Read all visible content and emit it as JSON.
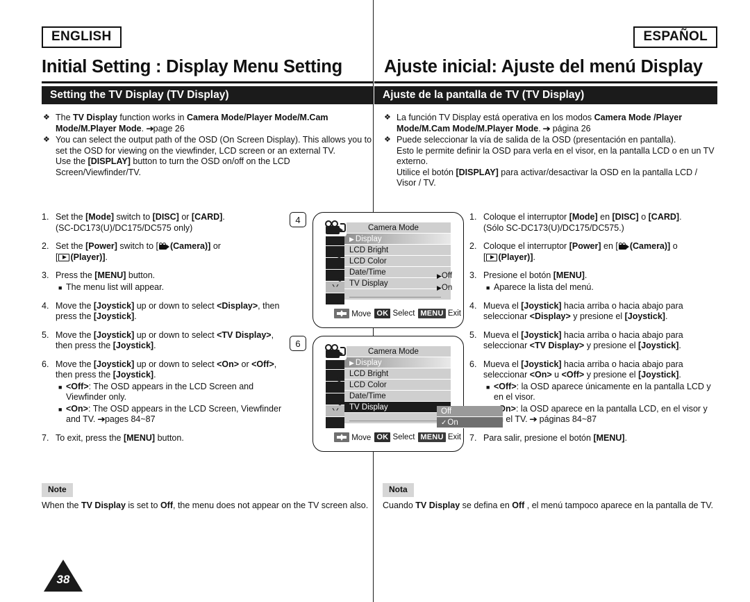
{
  "page": {
    "number": "38"
  },
  "english": {
    "lang_tag": "ENGLISH",
    "chapter_title": "Initial Setting : Display Menu Setting",
    "section_banner": "Setting the TV Display (TV Display)",
    "bullets": [
      {
        "marker": "diamond",
        "parts": [
          {
            "t": "The ",
            "b": false
          },
          {
            "t": "TV Display",
            "b": true
          },
          {
            "t": " function works in ",
            "b": false
          },
          {
            "t": "Camera Mode/Player Mode/M.Cam Mode/M.Player Mode",
            "b": true
          },
          {
            "t": ". ",
            "b": false
          },
          {
            "t": "page 26",
            "b": false,
            "arrow": true
          }
        ]
      },
      {
        "marker": "diamond",
        "parts": [
          {
            "t": "You can select the output path of the OSD (On Screen Display). This allows you to set the OSD for viewing on the viewfinder, LCD screen or an external TV.",
            "b": false
          },
          {
            "t": "BREAK",
            "b": false
          },
          {
            "t": "Use the ",
            "b": false
          },
          {
            "t": "[DISPLAY]",
            "b": true
          },
          {
            "t": " button to turn the OSD on/off on the LCD Screen/Viewfinder/TV.",
            "b": false
          }
        ]
      }
    ],
    "steps": [
      {
        "num": "1.",
        "parts": [
          {
            "t": "Set the ",
            "b": false
          },
          {
            "t": "[Mode]",
            "b": true
          },
          {
            "t": " switch to ",
            "b": false
          },
          {
            "t": "[DISC]",
            "b": true
          },
          {
            "t": " or ",
            "b": false
          },
          {
            "t": "[CARD]",
            "b": true
          },
          {
            "t": ".",
            "b": false
          },
          {
            "t": "BREAK",
            "b": false
          },
          {
            "t": "(SC-DC173(U)/DC175/DC575 only)",
            "b": false
          }
        ],
        "subs": []
      },
      {
        "num": "2.",
        "parts": [
          {
            "t": "Set the ",
            "b": false
          },
          {
            "t": "[Power]",
            "b": true
          },
          {
            "t": " switch to [",
            "b": false
          },
          {
            "t": "ICON_CAMERA",
            "b": false
          },
          {
            "t": "(Camera)]",
            "b": true
          },
          {
            "t": " or ",
            "b": false
          },
          {
            "t": "BREAK",
            "b": false
          },
          {
            "t": "[",
            "b": false
          },
          {
            "t": "ICON_PLAYER",
            "b": false
          },
          {
            "t": "(Player)]",
            "b": true
          },
          {
            "t": ".",
            "b": false
          }
        ],
        "subs": []
      },
      {
        "num": "3.",
        "parts": [
          {
            "t": "Press the ",
            "b": false
          },
          {
            "t": "[MENU]",
            "b": true
          },
          {
            "t": " button.",
            "b": false
          }
        ],
        "subs": [
          {
            "parts": [
              {
                "t": "The menu list will appear.",
                "b": false
              }
            ]
          }
        ]
      },
      {
        "num": "4.",
        "parts": [
          {
            "t": "Move the ",
            "b": false
          },
          {
            "t": "[Joystick]",
            "b": true
          },
          {
            "t": " up or down to select ",
            "b": false
          },
          {
            "t": "<Display>",
            "b": true
          },
          {
            "t": ", then press the ",
            "b": false
          },
          {
            "t": "[Joystick]",
            "b": true
          },
          {
            "t": ".",
            "b": false
          }
        ],
        "subs": []
      },
      {
        "num": "5.",
        "parts": [
          {
            "t": "Move the ",
            "b": false
          },
          {
            "t": "[Joystick]",
            "b": true
          },
          {
            "t": " up or down to select ",
            "b": false
          },
          {
            "t": "<TV Display>",
            "b": true
          },
          {
            "t": ", then press the ",
            "b": false
          },
          {
            "t": "[Joystick]",
            "b": true
          },
          {
            "t": ".",
            "b": false
          }
        ],
        "subs": []
      },
      {
        "num": "6.",
        "parts": [
          {
            "t": "Move the ",
            "b": false
          },
          {
            "t": "[Joystick]",
            "b": true
          },
          {
            "t": " up or down to select ",
            "b": false
          },
          {
            "t": "<On>",
            "b": true
          },
          {
            "t": " or ",
            "b": false
          },
          {
            "t": "<Off>",
            "b": true
          },
          {
            "t": ", then press the ",
            "b": false
          },
          {
            "t": "[Joystick]",
            "b": true
          },
          {
            "t": ".",
            "b": false
          }
        ],
        "subs": [
          {
            "parts": [
              {
                "t": "<Off>",
                "b": true
              },
              {
                "t": ": The OSD appears in the LCD Screen and Viewfinder only.",
                "b": false
              }
            ]
          },
          {
            "parts": [
              {
                "t": "<On>",
                "b": true
              },
              {
                "t": ": The OSD appears in the LCD Screen, Viewfinder and TV. ",
                "b": false
              },
              {
                "t": "pages 84~87",
                "b": false,
                "arrow": true
              }
            ]
          }
        ]
      },
      {
        "num": "7.",
        "parts": [
          {
            "t": "To exit, press the ",
            "b": false
          },
          {
            "t": "[MENU]",
            "b": true
          },
          {
            "t": " button.",
            "b": false
          }
        ],
        "subs": []
      }
    ],
    "note": {
      "tag": "Note",
      "parts": [
        {
          "t": "When the ",
          "b": false
        },
        {
          "t": "TV Display",
          "b": true
        },
        {
          "t": " is set to ",
          "b": false
        },
        {
          "t": "Off",
          "b": true
        },
        {
          "t": ", the menu does not appear on the TV screen also.",
          "b": false
        }
      ]
    }
  },
  "spanish": {
    "lang_tag": "ESPAÑOL",
    "chapter_title": "Ajuste inicial: Ajuste del menú Display",
    "section_banner": "Ajuste de la pantalla de TV (TV Display)",
    "bullets": [
      {
        "marker": "diamond",
        "parts": [
          {
            "t": "La función TV Display está operativa en los modos ",
            "b": false
          },
          {
            "t": "Camera Mode /Player Mode/M.Cam Mode/M.Player Mode",
            "b": true
          },
          {
            "t": ". ",
            "b": false
          },
          {
            "t": " página 26",
            "b": false,
            "arrow": true
          }
        ]
      },
      {
        "marker": "diamond",
        "parts": [
          {
            "t": "Puede seleccionar la vía de salida de la OSD (presentación en pantalla).",
            "b": false
          },
          {
            "t": "BREAK",
            "b": false
          },
          {
            "t": "Esto le permite definir la OSD para verla en el visor, en la pantalla LCD o en un TV externo.",
            "b": false
          },
          {
            "t": "BREAK",
            "b": false
          },
          {
            "t": "Utilice el botón ",
            "b": false
          },
          {
            "t": "[DISPLAY]",
            "b": true
          },
          {
            "t": " para activar/desactivar la OSD en la pantalla LCD / Visor / TV.",
            "b": false
          }
        ]
      }
    ],
    "steps": [
      {
        "num": "1.",
        "parts": [
          {
            "t": "Coloque el interruptor ",
            "b": false
          },
          {
            "t": "[Mode]",
            "b": true
          },
          {
            "t": " en ",
            "b": false
          },
          {
            "t": "[DISC]",
            "b": true
          },
          {
            "t": " o ",
            "b": false
          },
          {
            "t": "[CARD]",
            "b": true
          },
          {
            "t": ".",
            "b": false
          },
          {
            "t": "BREAK",
            "b": false
          },
          {
            "t": "(Sólo SC-DC173(U)/DC175/DC575.)",
            "b": false
          }
        ],
        "subs": []
      },
      {
        "num": "2.",
        "parts": [
          {
            "t": "Coloque el interruptor ",
            "b": false
          },
          {
            "t": "[Power]",
            "b": true
          },
          {
            "t": " en [",
            "b": false
          },
          {
            "t": "ICON_CAMERA",
            "b": false
          },
          {
            "t": "(Camera)]",
            "b": true
          },
          {
            "t": " o ",
            "b": false
          },
          {
            "t": "BREAK",
            "b": false
          },
          {
            "t": "[",
            "b": false
          },
          {
            "t": "ICON_PLAYER",
            "b": false
          },
          {
            "t": "(Player)]",
            "b": true
          },
          {
            "t": ".",
            "b": false
          }
        ],
        "subs": []
      },
      {
        "num": "3.",
        "parts": [
          {
            "t": "Presione el botón ",
            "b": false
          },
          {
            "t": "[MENU]",
            "b": true
          },
          {
            "t": ".",
            "b": false
          }
        ],
        "subs": [
          {
            "parts": [
              {
                "t": "Aparece la lista del menú.",
                "b": false
              }
            ]
          }
        ]
      },
      {
        "num": "4.",
        "parts": [
          {
            "t": "Mueva el ",
            "b": false
          },
          {
            "t": "[Joystick]",
            "b": true
          },
          {
            "t": " hacia arriba o hacia abajo para seleccionar ",
            "b": false
          },
          {
            "t": "<Display>",
            "b": true
          },
          {
            "t": " y presione el ",
            "b": false
          },
          {
            "t": "[Joystick]",
            "b": true
          },
          {
            "t": ".",
            "b": false
          }
        ],
        "subs": []
      },
      {
        "num": "5.",
        "parts": [
          {
            "t": "Mueva el ",
            "b": false
          },
          {
            "t": "[Joystick]",
            "b": true
          },
          {
            "t": " hacia arriba o hacia abajo para seleccionar ",
            "b": false
          },
          {
            "t": "<TV Display>",
            "b": true
          },
          {
            "t": " y presione el ",
            "b": false
          },
          {
            "t": "[Joystick]",
            "b": true
          },
          {
            "t": ".",
            "b": false
          }
        ],
        "subs": []
      },
      {
        "num": "6.",
        "parts": [
          {
            "t": "Mueva el ",
            "b": false
          },
          {
            "t": "[Joystick]",
            "b": true
          },
          {
            "t": " hacia arriba o hacia abajo para seleccionar ",
            "b": false
          },
          {
            "t": "<On>",
            "b": true
          },
          {
            "t": " u ",
            "b": false
          },
          {
            "t": "<Off>",
            "b": true
          },
          {
            "t": " y presione el ",
            "b": false
          },
          {
            "t": "[Joystick]",
            "b": true
          },
          {
            "t": ".",
            "b": false
          }
        ],
        "subs": [
          {
            "parts": [
              {
                "t": "<Off>",
                "b": true
              },
              {
                "t": ": la OSD aparece únicamente en la pantalla LCD y en el visor.",
                "b": false
              }
            ]
          },
          {
            "parts": [
              {
                "t": "<On>",
                "b": true
              },
              {
                "t": ": la OSD aparece en la pantalla LCD, en el visor y en el TV. ",
                "b": false
              },
              {
                "t": " páginas 84~87",
                "b": false,
                "arrow": true
              }
            ]
          }
        ]
      },
      {
        "num": "7.",
        "parts": [
          {
            "t": "Para salir, presione el botón ",
            "b": false
          },
          {
            "t": "[MENU]",
            "b": true
          },
          {
            "t": ".",
            "b": false
          }
        ],
        "subs": []
      }
    ],
    "note": {
      "tag": "Nota",
      "parts": [
        {
          "t": "Cuando ",
          "b": false
        },
        {
          "t": "TV Display",
          "b": true
        },
        {
          "t": " se defina en ",
          "b": false
        },
        {
          "t": "Off",
          "b": true
        },
        {
          "t": " , el menú tampoco aparece en la pantalla de TV.",
          "b": false
        }
      ]
    }
  },
  "illustrations": [
    {
      "step_tag": "4",
      "osd": {
        "title": "Camera Mode",
        "selected_row": "Display",
        "rows": [
          {
            "label": "Display",
            "value": "",
            "state": "selected",
            "caret": true
          },
          {
            "label": "LCD Bright",
            "value": "",
            "state": "normal",
            "caret": false
          },
          {
            "label": "LCD Color",
            "value": "",
            "state": "normal",
            "caret": false
          },
          {
            "label": "Date/Time",
            "value": "Off",
            "state": "normal",
            "caret": false
          },
          {
            "label": "TV Display",
            "value": "On",
            "state": "normal",
            "caret": false
          },
          {
            "label": "",
            "value": "",
            "state": "blank",
            "caret": false
          }
        ],
        "side_icons": [
          "record-icon",
          "tape-icon",
          "disc-icon",
          "tv-icon",
          "gear-icon"
        ],
        "highlighted_side_icon": "tv-icon",
        "hints": [
          {
            "key": "dpad",
            "label": "Move"
          },
          {
            "key": "OK",
            "label": "Select"
          },
          {
            "key": "MENU",
            "label": "Exit"
          }
        ]
      }
    },
    {
      "step_tag": "6",
      "osd": {
        "title": "Camera Mode",
        "selected_row": "TV Display",
        "rows": [
          {
            "label": "Display",
            "value": "",
            "state": "selected",
            "caret": true
          },
          {
            "label": "LCD Bright",
            "value": "",
            "state": "normal",
            "caret": false
          },
          {
            "label": "LCD Color",
            "value": "",
            "state": "normal",
            "caret": false
          },
          {
            "label": "Date/Time",
            "value": "",
            "state": "normal",
            "caret": false
          },
          {
            "label": "TV Display",
            "value": "",
            "state": "dark",
            "caret": false
          },
          {
            "label": "",
            "value": "",
            "state": "blank",
            "caret": false
          }
        ],
        "submenu": {
          "options": [
            {
              "label": "Off",
              "checked": false
            },
            {
              "label": "On",
              "checked": true
            }
          ]
        },
        "side_icons": [
          "record-icon",
          "tape-icon",
          "disc-icon",
          "tv-icon",
          "gear-icon"
        ],
        "highlighted_side_icon": "tv-icon",
        "hints": [
          {
            "key": "dpad",
            "label": "Move"
          },
          {
            "key": "OK",
            "label": "Select"
          },
          {
            "key": "MENU",
            "label": "Exit"
          }
        ]
      }
    }
  ]
}
